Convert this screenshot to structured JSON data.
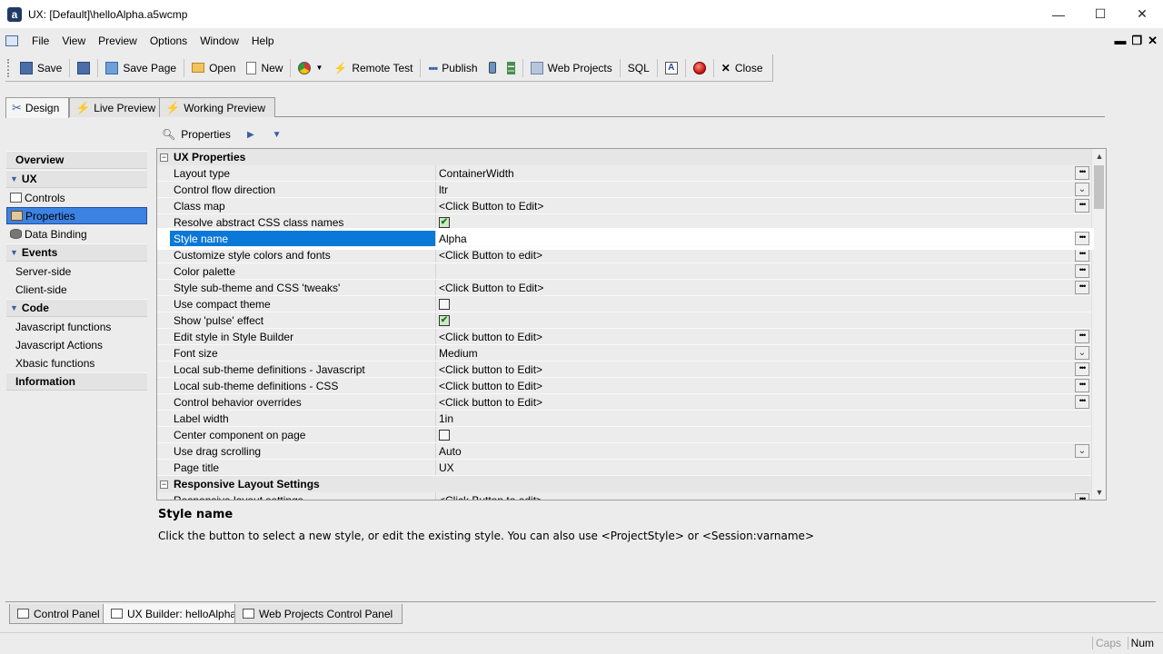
{
  "window": {
    "title": "UX: [Default]\\helloAlpha.a5wcmp",
    "minimize": "—",
    "maximize": "☐",
    "close": "✕"
  },
  "menu": {
    "items": [
      "File",
      "View",
      "Preview",
      "Options",
      "Window",
      "Help"
    ]
  },
  "toolbar": {
    "save": "Save",
    "save_page": "Save Page",
    "open": "Open",
    "new": "New",
    "remote_test": "Remote Test",
    "publish": "Publish",
    "web_projects": "Web Projects",
    "sql": "SQL",
    "close": "Close"
  },
  "tabs": [
    {
      "label": "Design",
      "active": true
    },
    {
      "label": "Live Preview",
      "active": false
    },
    {
      "label": "Working Preview",
      "active": false
    }
  ],
  "nav": {
    "overview": "Overview",
    "ux": "UX",
    "controls": "Controls",
    "properties": "Properties",
    "data_binding": "Data Binding",
    "events": "Events",
    "server_side": "Server-side",
    "client_side": "Client-side",
    "code": "Code",
    "js_functions": "Javascript functions",
    "js_actions": "Javascript Actions",
    "xbasic_functions": "Xbasic functions",
    "information": "Information"
  },
  "properties_header": "Properties",
  "grid": {
    "category_ux": "UX Properties",
    "category_responsive": "Responsive Layout Settings",
    "rows": [
      {
        "name": "Layout type",
        "value": "ContainerWidth",
        "ctrl": "ellipsis"
      },
      {
        "name": "Control flow direction",
        "value": "ltr",
        "ctrl": "dropdown"
      },
      {
        "name": "Class map",
        "value": "<Click Button to Edit>",
        "ctrl": "ellipsis"
      },
      {
        "name": "Resolve abstract CSS class names",
        "value": "",
        "ctrl": "checkbox",
        "checked": true
      },
      {
        "name": "Style name",
        "value": "Alpha",
        "ctrl": "ellipsis",
        "selected": true
      },
      {
        "name": "Customize style colors and fonts",
        "value": "<Click Button to edit>",
        "ctrl": "ellipsis"
      },
      {
        "name": "Color palette",
        "value": "",
        "ctrl": "ellipsis"
      },
      {
        "name": "Style sub-theme and CSS 'tweaks'",
        "value": "<Click Button to Edit>",
        "ctrl": "ellipsis"
      },
      {
        "name": "Use compact theme",
        "value": "",
        "ctrl": "checkbox",
        "checked": false
      },
      {
        "name": "Show 'pulse' effect",
        "value": "",
        "ctrl": "checkbox",
        "checked": true
      },
      {
        "name": "Edit style in Style Builder",
        "value": "<Click button to Edit>",
        "ctrl": "ellipsis"
      },
      {
        "name": "Font size",
        "value": "Medium",
        "ctrl": "dropdown"
      },
      {
        "name": "Local sub-theme definitions - Javascript",
        "value": "<Click button to Edit>",
        "ctrl": "ellipsis"
      },
      {
        "name": "Local sub-theme definitions - CSS",
        "value": "<Click button to Edit>",
        "ctrl": "ellipsis"
      },
      {
        "name": "Control behavior overrides",
        "value": "<Click button to Edit>",
        "ctrl": "ellipsis"
      },
      {
        "name": "Label width",
        "value": "1in",
        "ctrl": "none"
      },
      {
        "name": "Center component on page",
        "value": "",
        "ctrl": "checkbox",
        "checked": false
      },
      {
        "name": "Use drag scrolling",
        "value": "Auto",
        "ctrl": "dropdown"
      },
      {
        "name": "Page title",
        "value": "UX",
        "ctrl": "none"
      }
    ],
    "responsive_rows": [
      {
        "name": "Responsive layout settings",
        "value": "<Click Button to edit>",
        "ctrl": "ellipsis"
      }
    ]
  },
  "description": {
    "title": "Style name",
    "text": "Click the button to select a new style, or edit the existing style. You can also use <ProjectStyle> or <Session:varname>"
  },
  "bottom_tabs": [
    {
      "label": "Control Panel",
      "active": false
    },
    {
      "label": "UX Builder: helloAlpha",
      "active": true
    },
    {
      "label": "Web Projects Control Panel",
      "active": false
    }
  ],
  "status": {
    "caps": "Caps",
    "num": "Num"
  },
  "colors": {
    "selection": "#0a78d7",
    "nav_selected": "#3c82e3",
    "accent": "#3b5ea4"
  }
}
